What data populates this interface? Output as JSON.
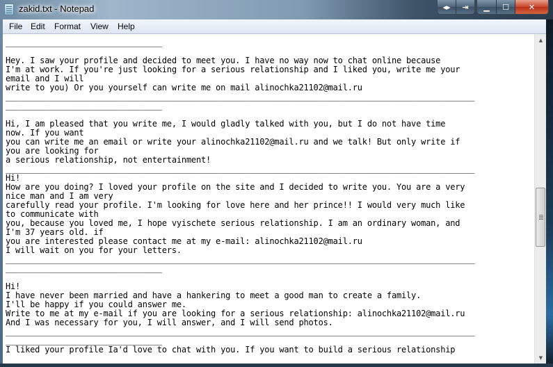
{
  "window": {
    "title": "zakid.txt - Notepad",
    "controls": {
      "extra1": "◂▸",
      "extra2": "⇥",
      "minimize": "▁",
      "maximize": "☐",
      "close": "✕"
    }
  },
  "menu": {
    "items": [
      "File",
      "Edit",
      "Format",
      "View",
      "Help"
    ]
  },
  "document": {
    "text": "________________________________\n\nHey. I saw your profile and decided to meet you. I have no way now to chat online because\nI'm at work. If you're just looking for a serious relationship and I liked you, write me your\nemail and I will\nwrite to you) Or you yourself can write me on mail alinochka21102@mail.ru\n________________________________________________________________________________________________\n________________________________\n\nHi, I am pleased that you write me, I would gladly talked with you, but I do not have time\nnow. If you want\nyou can write me an email or write your alinochka21102@mail.ru and we talk! But only write if\nyou are looking for\na serious relationship, not entertainment!\n________________________________________________________________________________________________\nHi!\nHow are you doing? I loved your profile on the site and I decided to write you. You are a very\nnice man and I am very\ncarefully read your profile. I'm looking for love here and her prince!! I would very much like\nto communicate with\nyou, because you loved me, I hope vyischete serious relationship. I am an ordinary woman, and\nI'm 37 years old. if\nyou are interested please contact me at my e-mail: alinochka21102@mail.ru\nI will wait on you for your letters.\n________________________________________________________________________________________________\n________________________________\n\nHi!\nI have never been married and have a hankering to meet a good man to create a family.\nI'll be happy if you could answer me.\nWrite to me at my e-mail if you are looking for a serious relationship: alinochka21102@mail.ru\nAnd I was necessary for you, I will answer, and I will send photos.\n________________________________________________________________________________________________\n________________________________\nI liked your profile Ia'd love to chat with you. If you want to build a serious relationship"
  },
  "scrollbar": {
    "up_arrow": "▲",
    "down_arrow": "▼",
    "position_fraction": 0.5
  }
}
